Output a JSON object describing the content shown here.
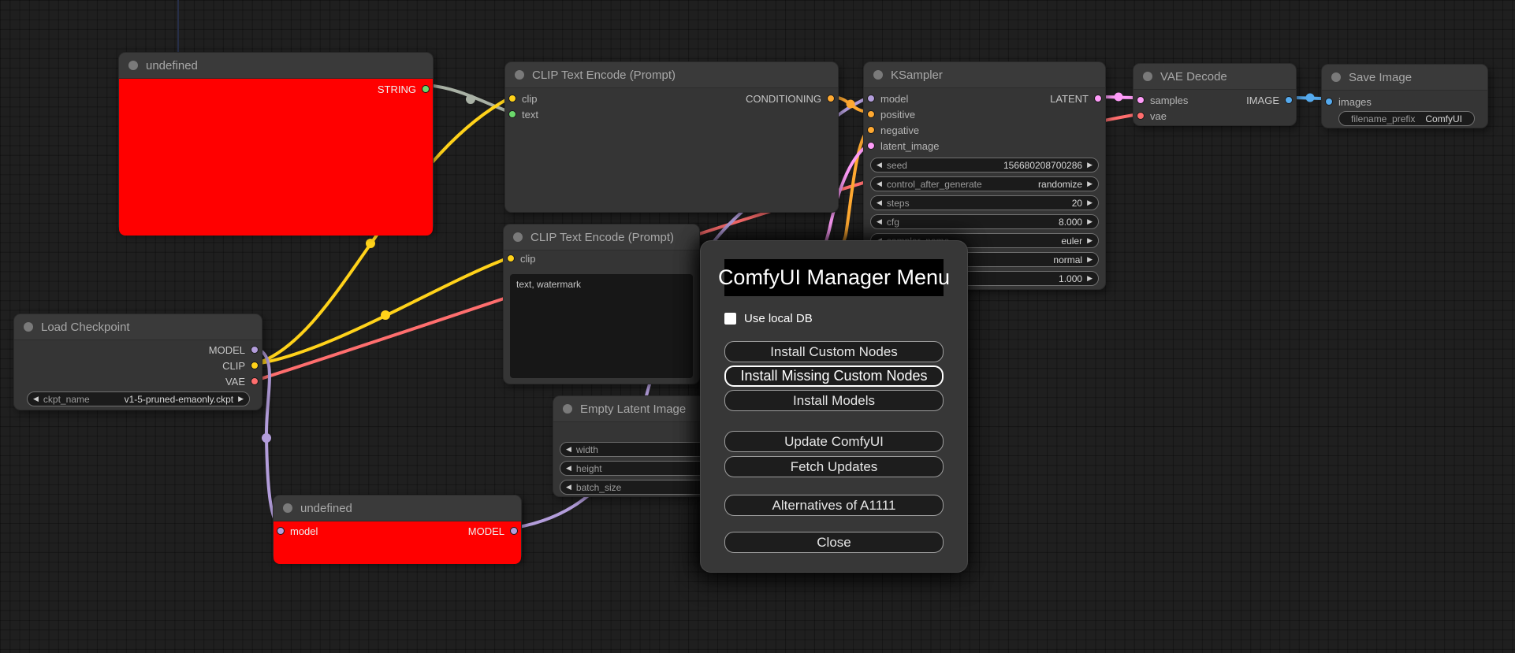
{
  "colors": {
    "string": "#6cd96c",
    "string_link": "#a9b1a5",
    "clip": "#ffd21a",
    "vae": "#ff6e6e",
    "model": "#b39ddb",
    "conditioning": "#ffa931",
    "latent": "#ff9cf9",
    "image": "#55aaee",
    "missing_node": "#ff0000"
  },
  "nodes": {
    "undefined_top": {
      "title": "undefined",
      "outputs": {
        "string": "STRING"
      }
    },
    "clip_encode_1": {
      "title": "CLIP Text Encode (Prompt)",
      "inputs": {
        "clip": "clip",
        "text": "text"
      },
      "outputs": {
        "conditioning": "CONDITIONING"
      }
    },
    "ksampler": {
      "title": "KSampler",
      "inputs": {
        "model": "model",
        "positive": "positive",
        "negative": "negative",
        "latent_image": "latent_image"
      },
      "outputs": {
        "latent": "LATENT"
      },
      "widgets": [
        {
          "label": "seed",
          "value": "156680208700286"
        },
        {
          "label": "control_after_generate",
          "value": "randomize"
        },
        {
          "label": "steps",
          "value": "20"
        },
        {
          "label": "cfg",
          "value": "8.000"
        },
        {
          "label": "sampler_name",
          "value": "euler"
        },
        {
          "label": "",
          "value": "normal"
        },
        {
          "label": "",
          "value": "1.000"
        }
      ]
    },
    "vae_decode": {
      "title": "VAE Decode",
      "inputs": {
        "samples": "samples",
        "vae": "vae"
      },
      "outputs": {
        "image": "IMAGE"
      }
    },
    "save_image": {
      "title": "Save Image",
      "inputs": {
        "images": "images"
      },
      "widgets": [
        {
          "label": "filename_prefix",
          "value": "ComfyUI"
        }
      ]
    },
    "clip_encode_2": {
      "title": "CLIP Text Encode (Prompt)",
      "inputs": {
        "clip": "clip"
      },
      "prompt_text": "text, watermark"
    },
    "load_checkpoint": {
      "title": "Load Checkpoint",
      "outputs": {
        "model": "MODEL",
        "clip": "CLIP",
        "vae": "VAE"
      },
      "widgets": [
        {
          "label": "ckpt_name",
          "value": "v1-5-pruned-emaonly.ckpt"
        }
      ]
    },
    "empty_latent": {
      "title": "Empty Latent Image",
      "widgets": [
        {
          "label": "width",
          "value": ""
        },
        {
          "label": "height",
          "value": ""
        },
        {
          "label": "batch_size",
          "value": ""
        }
      ]
    },
    "undefined_bottom": {
      "title": "undefined",
      "inputs": {
        "model": "model"
      },
      "outputs": {
        "model": "MODEL"
      }
    }
  },
  "menu": {
    "title": "ComfyUI Manager Menu",
    "checkbox_label": "Use local DB",
    "buttons": [
      {
        "label": "Install Custom Nodes"
      },
      {
        "label": "Install Missing Custom Nodes"
      },
      {
        "label": "Install Models"
      },
      {
        "label": "Update ComfyUI"
      },
      {
        "label": "Fetch Updates"
      },
      {
        "label": "Alternatives of A1111"
      },
      {
        "label": "Close"
      }
    ]
  }
}
